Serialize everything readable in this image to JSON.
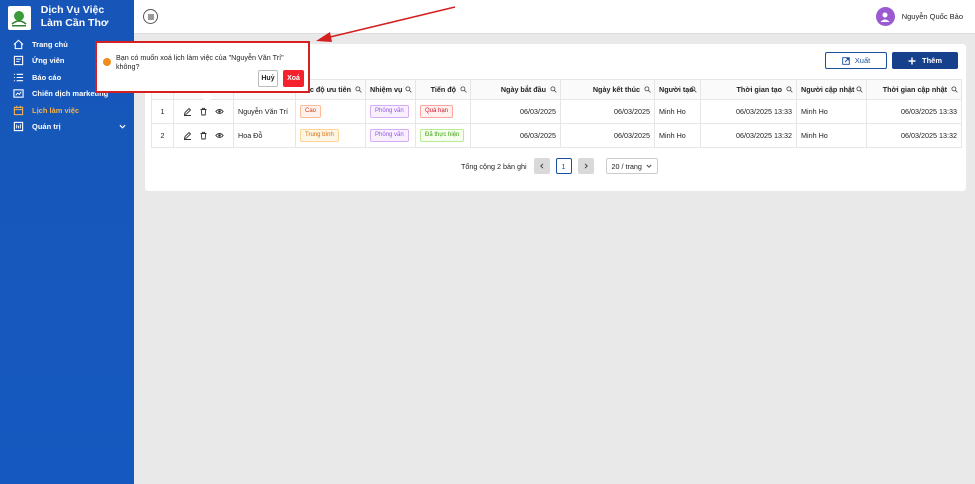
{
  "brand": {
    "title": "Dịch Vụ Việc Làm Cần Thơ"
  },
  "sidebar": {
    "items": [
      {
        "label": "Trang chủ",
        "icon": "home-icon"
      },
      {
        "label": "Ứng viên",
        "icon": "candidate-icon"
      },
      {
        "label": "Báo cáo",
        "icon": "list-icon"
      },
      {
        "label": "Chiến dịch marketing",
        "icon": "campaign-icon"
      },
      {
        "label": "Lịch làm việc",
        "icon": "calendar-icon",
        "active": true
      },
      {
        "label": "Quản trị",
        "icon": "admin-icon"
      }
    ]
  },
  "header": {
    "user_name": "Nguyễn Quốc Bảo"
  },
  "toolbar": {
    "export_label": "Xuất",
    "add_label": "Thêm"
  },
  "table": {
    "columns": [
      "",
      "",
      "",
      "ức độ ưu tiên",
      "Nhiệm vụ",
      "Tiến độ",
      "Ngày bắt đầu",
      "Ngày kết thúc",
      "Người tạo",
      "Thời gian tạo",
      "Người cập nhật",
      "Thời gian cập nhật"
    ],
    "rows": [
      {
        "index": "1",
        "name": "Nguyễn Văn Trí",
        "priority": "Cao",
        "task": "Phỏng vấn",
        "progress": "Quá hạn",
        "start": "06/03/2025",
        "end": "06/03/2025",
        "creator": "Minh Ho",
        "created_at": "06/03/2025 13:33",
        "updater": "Minh Ho",
        "updated_at": "06/03/2025 13:33"
      },
      {
        "index": "2",
        "name": "Hoa Đỗ",
        "priority": "Trung bình",
        "task": "Phỏng vấn",
        "progress": "Đã thực hiện",
        "start": "06/03/2025",
        "end": "06/03/2025",
        "creator": "Minh Ho",
        "created_at": "06/03/2025 13:32",
        "updater": "Minh Ho",
        "updated_at": "06/03/2025 13:32"
      }
    ]
  },
  "pagination": {
    "total_text": "Tổng cộng 2 bản ghi",
    "current_page": "1",
    "page_size": "20 / trang"
  },
  "popconfirm": {
    "message": "Bạn có muốn xoá lịch làm việc của \"Nguyễn Văn Trí\" không?",
    "cancel_label": "Huỷ",
    "ok_label": "Xoá"
  },
  "colors": {
    "sidebar": "#1559c0",
    "accent": "#163f8c",
    "danger": "#f5222d",
    "active_nav": "#f5b14b",
    "annotation": "#d42020"
  }
}
